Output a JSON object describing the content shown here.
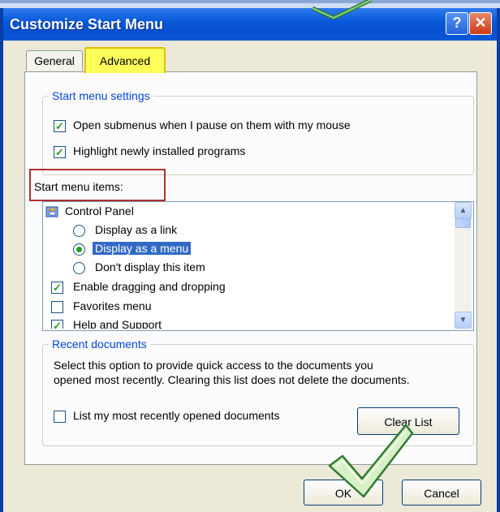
{
  "window": {
    "title": "Customize Start Menu",
    "help_glyph": "?",
    "close_glyph": "✕"
  },
  "tabs": [
    {
      "label": "General",
      "selected": false
    },
    {
      "label": "Advanced",
      "selected": true
    }
  ],
  "start_menu_settings": {
    "legend": "Start menu settings",
    "options": [
      {
        "label": "Open submenus when I pause on them with my mouse",
        "checked": true
      },
      {
        "label": "Highlight newly installed programs",
        "checked": true
      }
    ]
  },
  "start_menu_items": {
    "label": "Start menu items:",
    "control_panel": "Control Panel",
    "radios": [
      {
        "label": "Display as a link",
        "selected": false
      },
      {
        "label": "Display as a menu",
        "selected": true
      },
      {
        "label": "Don't display this item",
        "selected": false
      }
    ],
    "checks": [
      {
        "label": "Enable dragging and dropping",
        "checked": true
      },
      {
        "label": "Favorites menu",
        "checked": false
      },
      {
        "label": "Help and Support",
        "checked": true
      }
    ]
  },
  "recent_documents": {
    "legend": "Recent documents",
    "description_line1": "Select this option to provide quick access to the documents you",
    "description_line2": "opened most recently.  Clearing this list does not delete the documents.",
    "checkbox_label": "List my most recently opened documents",
    "checked": false,
    "clear_button": "Clear List"
  },
  "buttons": {
    "ok": "OK",
    "cancel": "Cancel"
  },
  "icons": {
    "control_panel": "control-panel-icon",
    "scroll_up": "▲",
    "scroll_down": "▼"
  },
  "colors": {
    "titlebar": "#0a5ad8",
    "group_label": "#0046d5",
    "tab_highlight": "#ffff5a",
    "callout_box": "#b03030",
    "checkmark": "#21a121"
  }
}
